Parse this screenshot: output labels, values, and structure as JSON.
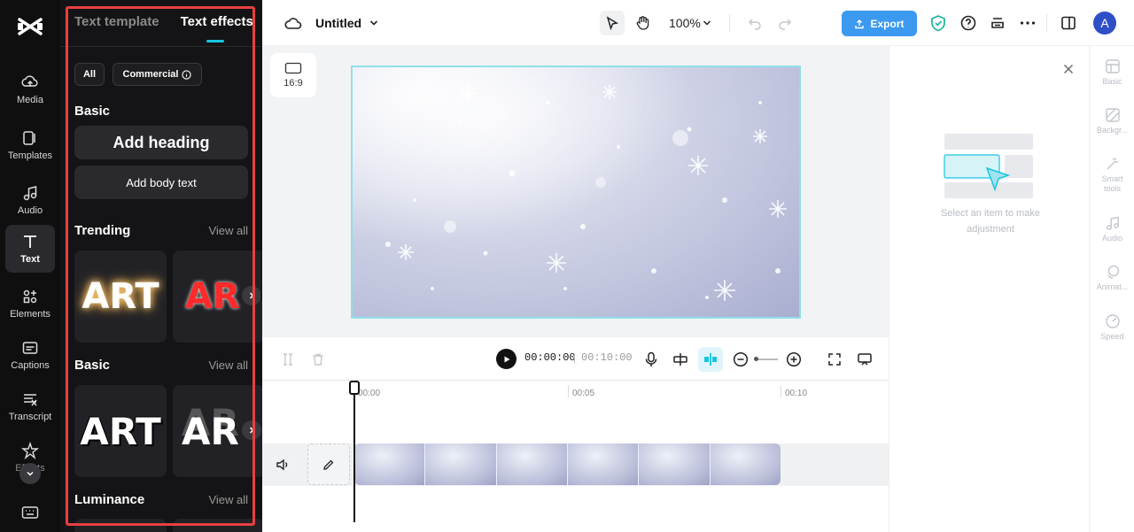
{
  "rail": {
    "items": [
      {
        "label": "Media",
        "icon": "media-icon"
      },
      {
        "label": "Templates",
        "icon": "templates-icon"
      },
      {
        "label": "Audio",
        "icon": "audio-icon"
      },
      {
        "label": "Text",
        "icon": "text-icon",
        "active": true
      },
      {
        "label": "Elements",
        "icon": "elements-icon"
      },
      {
        "label": "Captions",
        "icon": "captions-icon"
      },
      {
        "label": "Transcript",
        "icon": "transcript-icon"
      },
      {
        "label": "Effects",
        "icon": "effects-icon"
      }
    ]
  },
  "panel": {
    "tabs": [
      {
        "label": "Text template",
        "active": false
      },
      {
        "label": "Text effects",
        "active": true
      }
    ],
    "filters": {
      "all": "All",
      "commercial": "Commercial"
    },
    "basic_title": "Basic",
    "add_heading": "Add heading",
    "add_body": "Add body text",
    "trending_title": "Trending",
    "basic2_title": "Basic",
    "luminance_title": "Luminance",
    "view_all": "View all",
    "card_text": "ART",
    "card_text_cut": "AR"
  },
  "topbar": {
    "title": "Untitled",
    "zoom": "100%",
    "export": "Export",
    "avatar": "A"
  },
  "canvas": {
    "ratio": "16:9"
  },
  "playback": {
    "current": "00:00:00",
    "separator": "|",
    "duration": "00:10:00"
  },
  "timeline": {
    "ruler": [
      "00:00",
      "00:05",
      "00:10"
    ]
  },
  "right_panel": {
    "hint": "Select an item to make adjustment"
  },
  "right_rail": {
    "items": [
      {
        "label": "Basic",
        "icon": "basic-icon"
      },
      {
        "label": "Backgr...",
        "icon": "background-icon"
      },
      {
        "label": "Smart tools",
        "icon": "smart-tools-icon"
      },
      {
        "label": "Audio",
        "icon": "audio-icon"
      },
      {
        "label": "Animat...",
        "icon": "animation-icon"
      },
      {
        "label": "Speed",
        "icon": "speed-icon"
      }
    ]
  },
  "colors": {
    "accent": "#19c5e0",
    "export": "#3b99f0",
    "highlight": "#e8403f"
  }
}
